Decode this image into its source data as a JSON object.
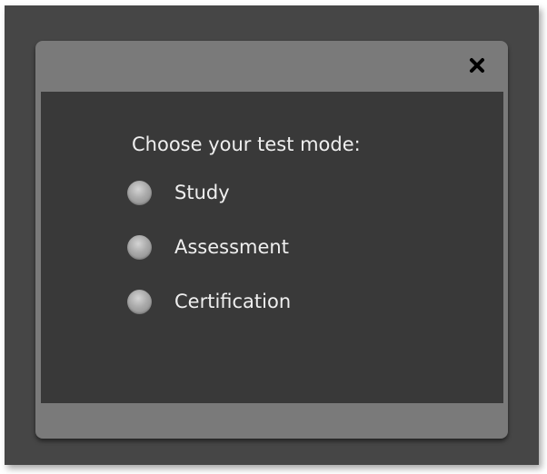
{
  "dialog": {
    "close_icon": "close-icon",
    "prompt": "Choose your test mode:",
    "options": [
      {
        "label": "Study",
        "selected": false
      },
      {
        "label": "Assessment",
        "selected": false
      },
      {
        "label": "Certification",
        "selected": false
      }
    ]
  },
  "colors": {
    "backdrop": "#464646",
    "dialog_frame": "#7a7a7a",
    "content_panel": "#393939",
    "text": "#efefef"
  }
}
